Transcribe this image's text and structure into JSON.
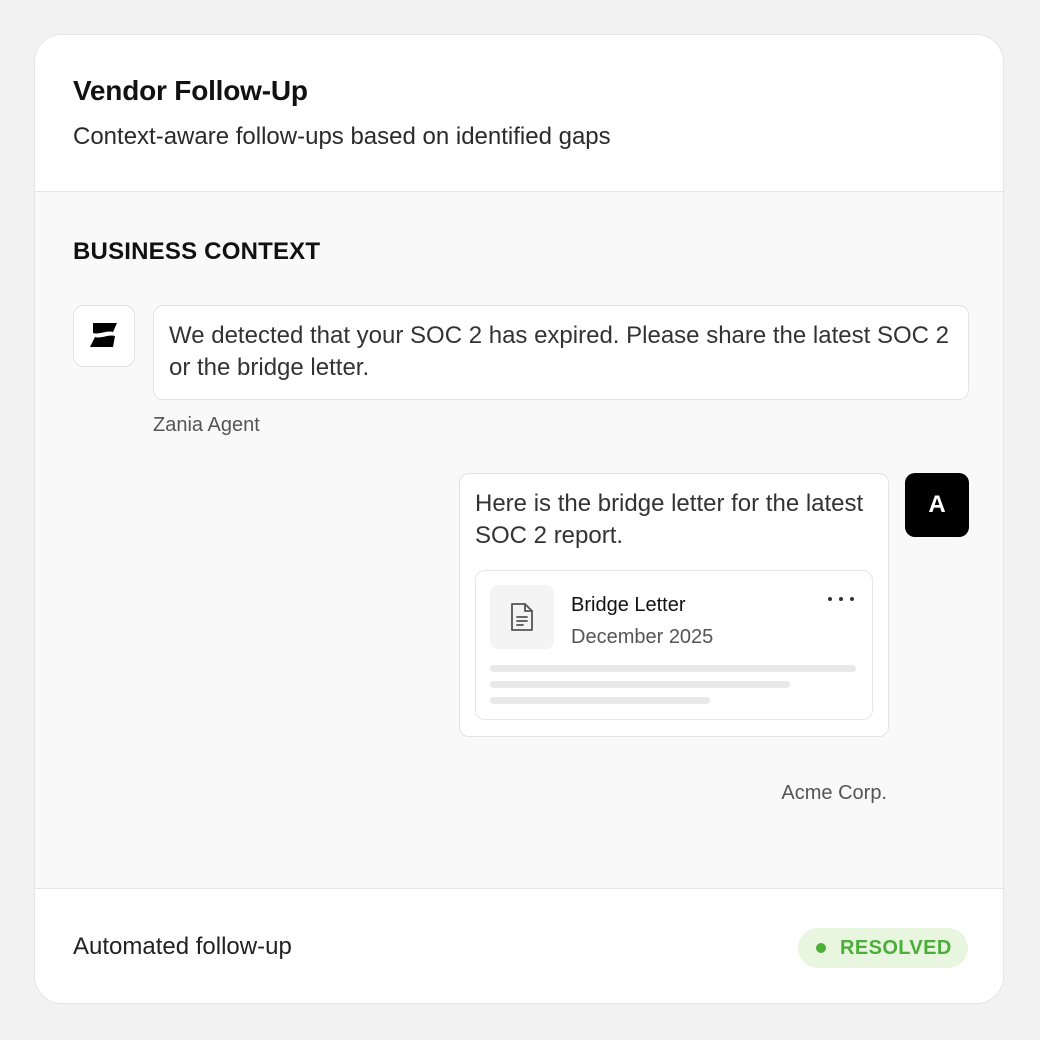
{
  "header": {
    "title": "Vendor Follow-Up",
    "subtitle": "Context-aware follow-ups based on identified gaps"
  },
  "section": {
    "label": "BUSINESS CONTEXT"
  },
  "messages": [
    {
      "sender": "Zania Agent",
      "avatar_icon": "zania-logo-icon",
      "text": "We detected that your SOC 2 has expired. Please share the latest SOC 2 or the bridge letter."
    },
    {
      "sender": "Acme Corp.",
      "avatar_initial": "A",
      "text": "Here is the bridge letter for the latest SOC 2 report.",
      "attachment": {
        "icon": "document-icon",
        "name": "Bridge Letter",
        "date": "December 2025",
        "menu_icon": "more-horizontal-icon"
      }
    }
  ],
  "footer": {
    "label": "Automated follow-up",
    "status": {
      "text": "RESOLVED",
      "color": "#4cad3a",
      "background": "#e8f6e0"
    }
  }
}
